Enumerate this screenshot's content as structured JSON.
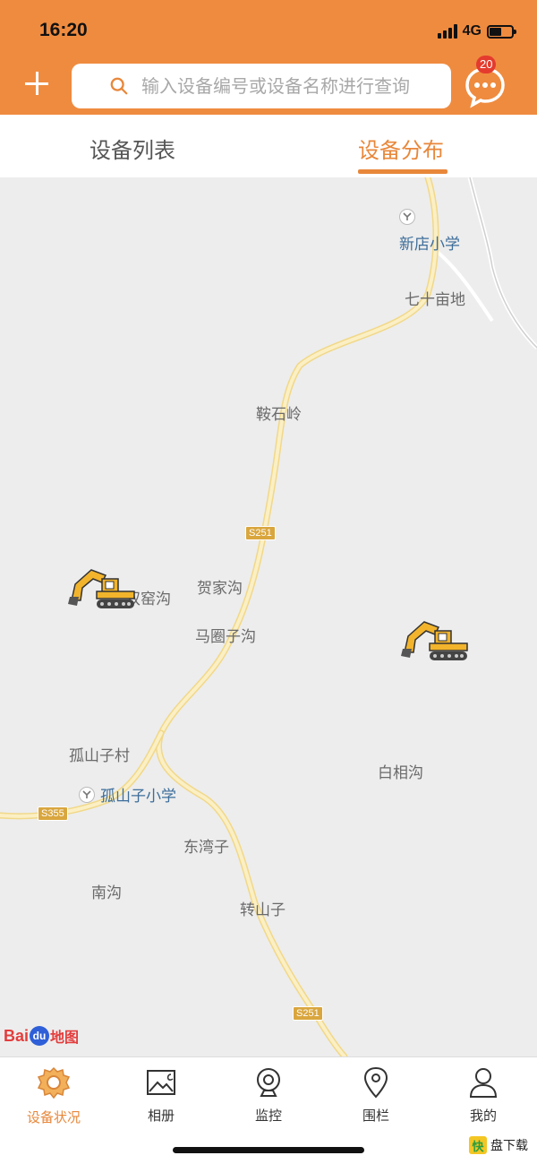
{
  "status_bar": {
    "time": "16:20",
    "network": "4G"
  },
  "header": {
    "search_placeholder": "输入设备编号或设备名称进行查询",
    "message_badge": "20",
    "accent_color": "#ef8b3f"
  },
  "tabs": [
    {
      "label": "设备列表",
      "active": false
    },
    {
      "label": "设备分布",
      "active": true
    }
  ],
  "map": {
    "places": [
      "七十亩地",
      "鞍石岭",
      "双窑沟",
      "贺家沟",
      "马圈子沟",
      "孤山子村",
      "白相沟",
      "东湾子",
      "南沟",
      "转山子"
    ],
    "pois": [
      "新店小学",
      "孤山子小学"
    ],
    "road_shields": [
      "S251",
      "S355",
      "S251"
    ],
    "markers": [
      {
        "type": "excavator-icon"
      },
      {
        "type": "excavator-icon"
      }
    ],
    "logo": {
      "text_bai": "Bai",
      "text_du": "du",
      "text_map": "地图"
    }
  },
  "tabbar": [
    {
      "label": "设备状况",
      "icon": "gear-icon",
      "active": true
    },
    {
      "label": "相册",
      "icon": "album-icon",
      "active": false
    },
    {
      "label": "监控",
      "icon": "camera-icon",
      "active": false
    },
    {
      "label": "围栏",
      "icon": "location-pin-icon",
      "active": false
    },
    {
      "label": "我的",
      "icon": "user-icon",
      "active": false
    }
  ],
  "watermark": {
    "box": "快",
    "text": "盘下载"
  }
}
